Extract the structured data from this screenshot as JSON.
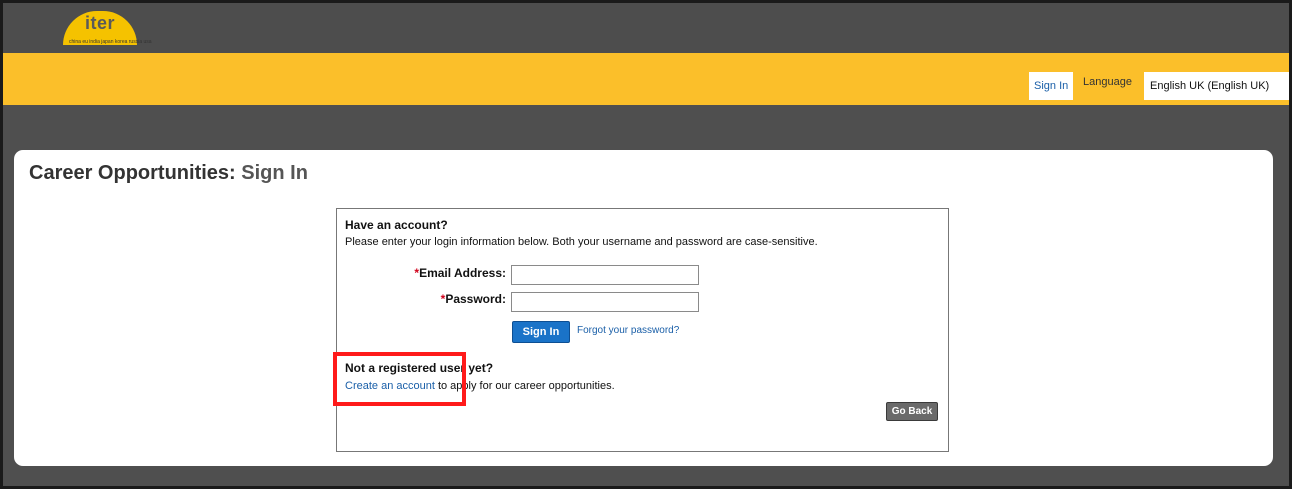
{
  "header": {
    "logo_text": "iter",
    "logo_tagline": "china eu india japan korea russia usa",
    "signin_link": "Sign In",
    "language_label": "Language",
    "language_value": "English UK (English UK)"
  },
  "page": {
    "title_main": "Career Opportunities:",
    "title_sub": "Sign In"
  },
  "login": {
    "heading": "Have an account?",
    "instructions": "Please enter your login information below. Both your username and password are case-sensitive.",
    "required_marker": "*",
    "email_label": "Email Address:",
    "password_label": "Password:",
    "email_value": "",
    "password_value": "",
    "signin_button": "Sign In",
    "forgot_link": "Forgot your password?"
  },
  "register": {
    "heading": "Not a registered user yet?",
    "create_link": "Create an account",
    "create_suffix": " to apply for our career opportunities."
  },
  "actions": {
    "go_back": "Go Back"
  },
  "colors": {
    "header_dark": "#4d4d4d",
    "header_yellow": "#fbbf2a",
    "link_blue": "#1a5fa8",
    "button_blue": "#1a73c8",
    "highlight_red": "#ff1a1a"
  }
}
